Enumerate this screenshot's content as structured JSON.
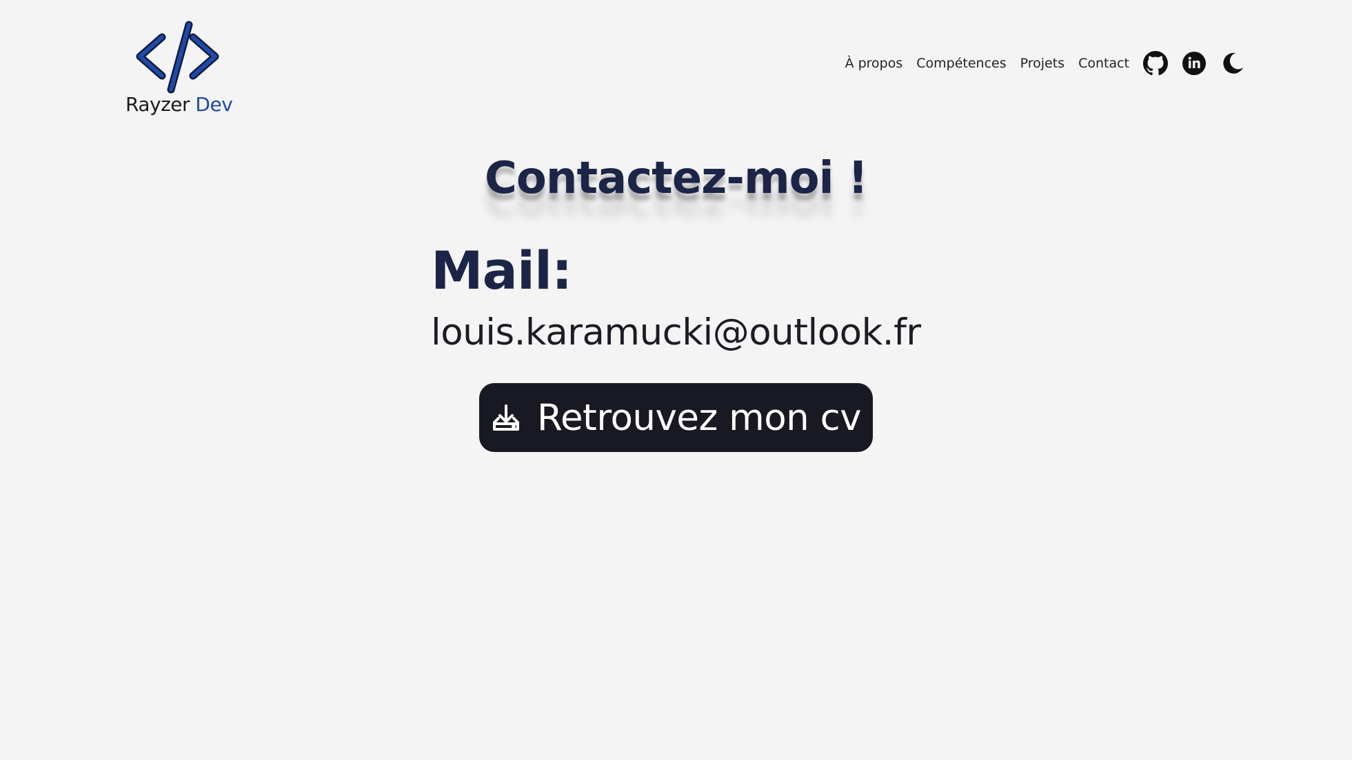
{
  "logo": {
    "name_part1": "Rayzer",
    "name_part2": "Dev",
    "icon": "code-brackets-icon",
    "accent_color": "#1f4aa8"
  },
  "nav": {
    "items": [
      {
        "label": "À propos"
      },
      {
        "label": "Compétences"
      },
      {
        "label": "Projets"
      },
      {
        "label": "Contact"
      }
    ],
    "icons": [
      "github-icon",
      "linkedin-icon",
      "moon-icon"
    ]
  },
  "contact": {
    "heading": "Contactez-moi !",
    "mail_label": "Mail:",
    "mail_value": "louis.karamucki@outlook.fr",
    "cv_button_label": "Retrouvez mon cv",
    "cv_button_icon": "download-icon"
  },
  "colors": {
    "background": "#f4f4f4",
    "heading": "#1b2547",
    "button_bg": "#181922"
  }
}
